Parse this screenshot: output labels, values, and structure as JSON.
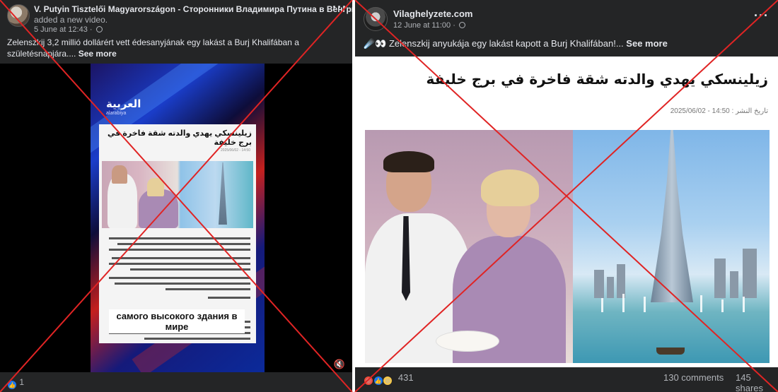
{
  "left_post": {
    "author": "V. Putyin Tisztelői Magyarországon - Сторонники Владимира Путина в Венгрии",
    "action": "added a new video.",
    "timestamp": "5 June at 12:43 ·",
    "caption": "Zelenszkij 3,2 millió dollárért vett édesanyjának egy lakást a Burj Khalifában a születésnapjára....",
    "see_more": "See more",
    "video": {
      "channel_name": "العربية",
      "channel_sub": "alarabiya",
      "article_headline": "زيلينسكي يهدي والدته شقة فاخرة في برج خليفة",
      "article_date": "2025/06/02 - 14:50",
      "overlay_text": "самого высокого здания в мире"
    },
    "reaction_count": "1"
  },
  "right_post": {
    "author": "Vilaghelyzete.com",
    "timestamp": "12 June at 11:00 ·",
    "caption": "☄️👀 Zelenszkij anyukája egy lakást kapott a Burj Khalifában!...",
    "see_more": "See more",
    "article_headline": "زيلينسكي يهدي والدته شقة فاخرة في برج خليفة",
    "article_date": "تاريخ النشر : 14:50 - 2025/06/02",
    "reaction_count": "431",
    "comments": "130 comments",
    "shares": "145 shares"
  },
  "icons": {
    "more_icon": "···",
    "like_icon": "👍",
    "haha_icon": "😆",
    "angry_icon": "😡",
    "mute_icon": "🔇"
  },
  "colors": {
    "background": "#242526",
    "cross": "#e02424",
    "like_blue": "#1877f2"
  }
}
